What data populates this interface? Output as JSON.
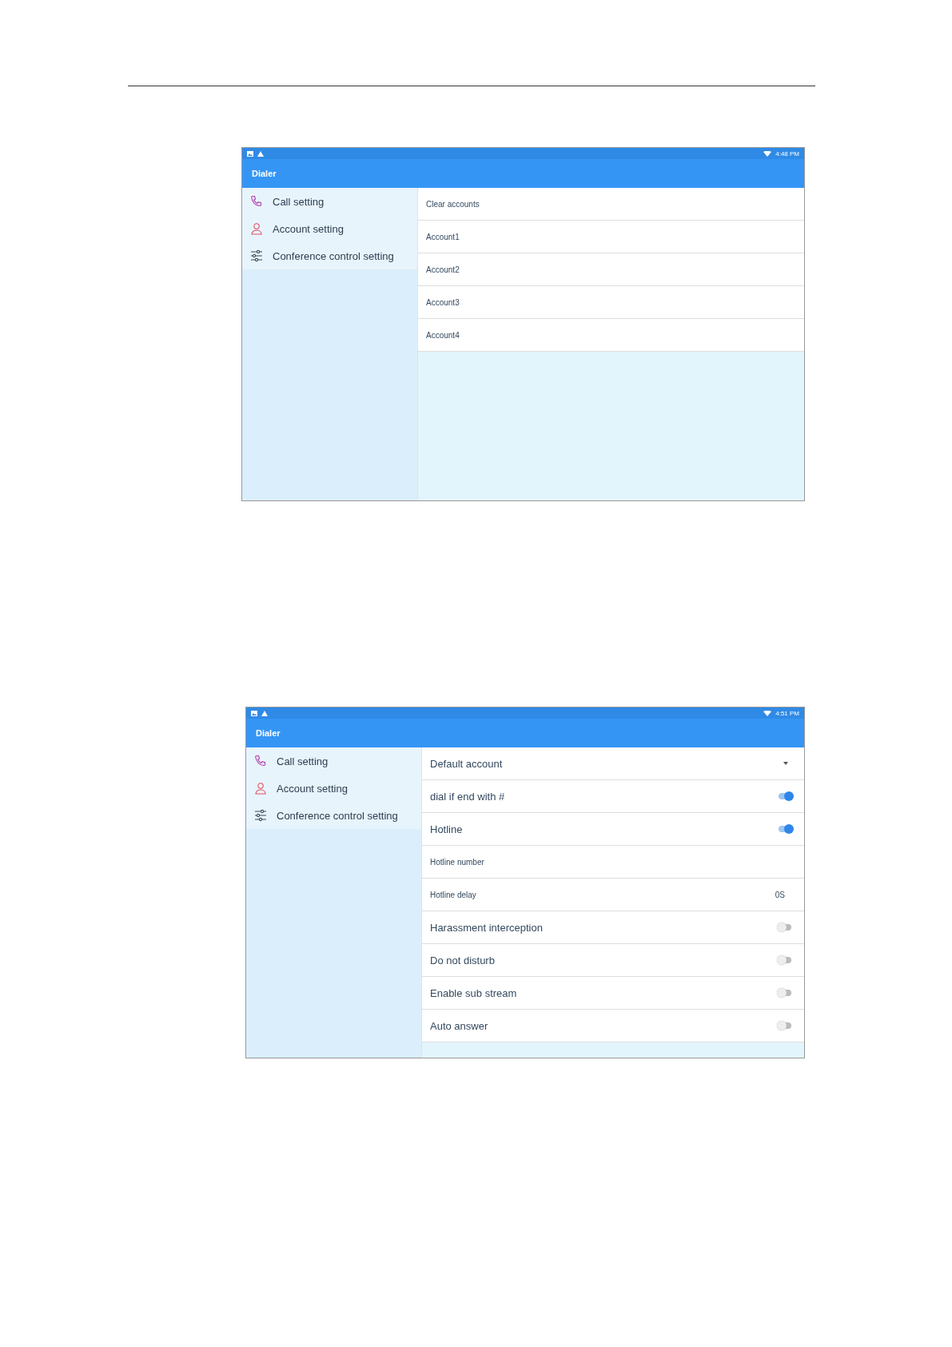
{
  "screens": [
    {
      "status_bar": {
        "time": "4:48 PM"
      },
      "app_bar": {
        "title": "Dialer"
      },
      "sidebar": {
        "items": [
          {
            "label": "Call setting",
            "kind": "phone"
          },
          {
            "label": "Account setting",
            "kind": "person"
          },
          {
            "label": "Conference control setting",
            "kind": "sliders"
          }
        ]
      },
      "rows": [
        {
          "label": "Clear accounts",
          "kind": "text"
        },
        {
          "label": "Account1",
          "kind": "text"
        },
        {
          "label": "Account2",
          "kind": "text"
        },
        {
          "label": "Account3",
          "kind": "text"
        },
        {
          "label": "Account4",
          "kind": "text"
        }
      ]
    },
    {
      "status_bar": {
        "time": "4:51 PM"
      },
      "app_bar": {
        "title": "Dialer"
      },
      "sidebar": {
        "items": [
          {
            "label": "Call setting",
            "kind": "phone"
          },
          {
            "label": "Account setting",
            "kind": "person"
          },
          {
            "label": "Conference control setting",
            "kind": "sliders"
          }
        ]
      },
      "rows": [
        {
          "label": "Default account",
          "kind": "dropdown"
        },
        {
          "label": "dial if end with #",
          "kind": "toggle",
          "on": true
        },
        {
          "label": "Hotline",
          "kind": "toggle",
          "on": true
        },
        {
          "label": "Hotline number",
          "kind": "text"
        },
        {
          "label": "Hotline delay",
          "kind": "value",
          "value": "0S"
        },
        {
          "label": "Harassment interception",
          "kind": "toggle",
          "on": false
        },
        {
          "label": "Do not disturb",
          "kind": "toggle",
          "on": false
        },
        {
          "label": "Enable sub stream",
          "kind": "toggle",
          "on": false
        },
        {
          "label": "Auto answer",
          "kind": "toggle",
          "on": false
        }
      ]
    }
  ]
}
